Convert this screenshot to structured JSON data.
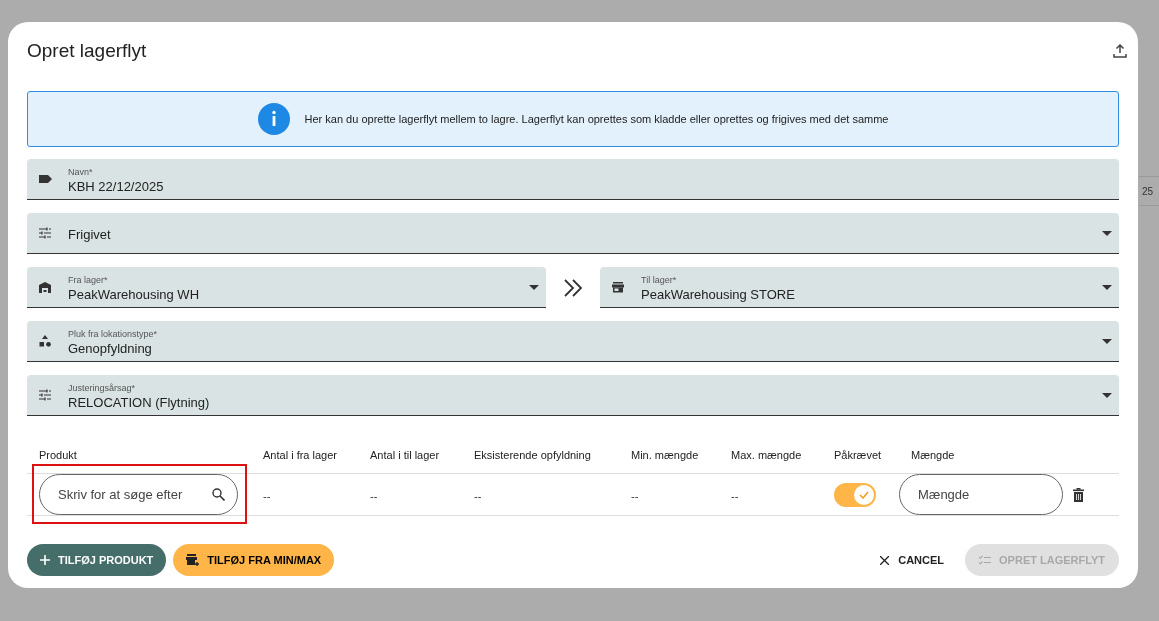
{
  "background": {
    "cell_text": "25"
  },
  "dialog": {
    "title": "Opret lagerflyt"
  },
  "info": "Her kan du oprette lagerflyt mellem to lagre. Lagerflyt kan oprettes som kladde eller oprettes og frigives med det samme",
  "fields": [
    {
      "kind": "text",
      "label": "Navn*",
      "value": "KBH 22/12/2025"
    },
    {
      "kind": "select",
      "value": "Frigivet"
    },
    {
      "kind": "pair",
      "from": {
        "label": "Fra lager*",
        "value": "PeakWarehousing WH"
      },
      "to": {
        "label": "Til lager*",
        "value": "PeakWarehousing STORE"
      }
    },
    {
      "kind": "select",
      "label": "Pluk fra lokationstype*",
      "value": "Genopfyldning"
    },
    {
      "kind": "select",
      "label": "Justeringsårsag*",
      "value": "RELOCATION (Flytning)"
    }
  ],
  "table": {
    "columns": [
      "Produkt",
      "Antal i fra lager",
      "Antal i til lager",
      "Eksisterende opfyldning",
      "Min. mængde",
      "Max. mængde",
      "Påkrævet",
      "Mængde"
    ],
    "rows": [
      {
        "cells": [
          {
            "kind": "search",
            "placeholder": "Skriv for at søge efter",
            "highlighted": true
          },
          {
            "kind": "text",
            "text": "--"
          },
          {
            "kind": "text",
            "text": "--"
          },
          {
            "kind": "text",
            "text": "--"
          },
          {
            "kind": "text",
            "text": "--"
          },
          {
            "kind": "text",
            "text": "--"
          },
          {
            "kind": "toggle",
            "on": true
          },
          {
            "kind": "input",
            "placeholder": "Mængde"
          }
        ]
      }
    ]
  },
  "buttons": {
    "add_product": "TILFØJ PRODUKT",
    "add_minmax": "TILFØJ FRA MIN/MAX",
    "cancel": "CANCEL",
    "create": {
      "label": "OPRET LAGERFLYT",
      "disabled": true
    }
  }
}
